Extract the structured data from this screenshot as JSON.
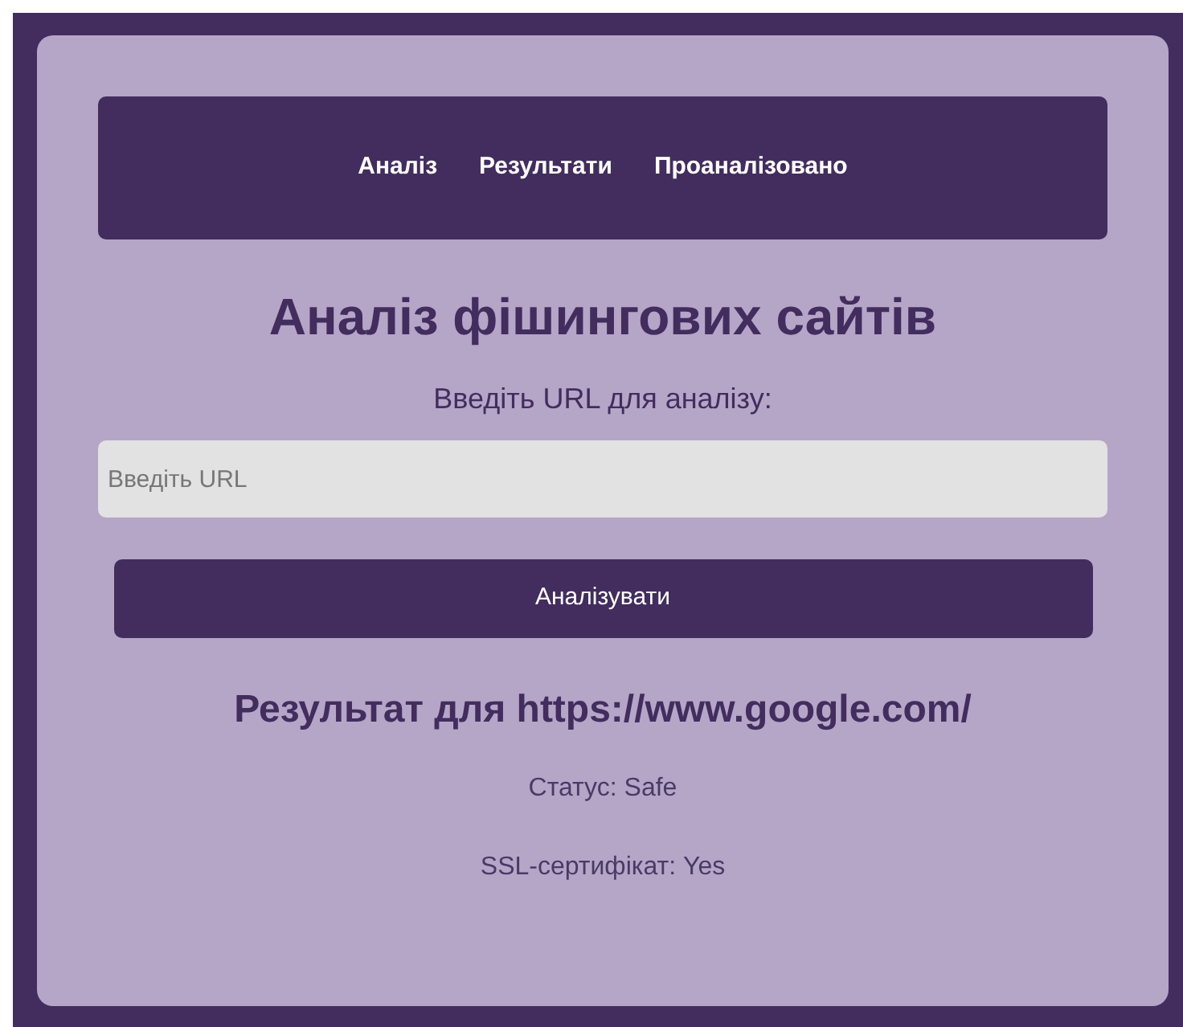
{
  "nav": {
    "items": [
      "Аналіз",
      "Результати",
      "Проаналізовано"
    ]
  },
  "title": "Аналіз фішингових сайтів",
  "form": {
    "label": "Введіть URL для аналізу:",
    "placeholder": "Введіть URL",
    "button": "Аналізувати"
  },
  "result": {
    "heading": "Результат для https://www.google.com/",
    "lines": [
      "Статус: Safe",
      "SSL-сертифікат: Yes"
    ]
  }
}
